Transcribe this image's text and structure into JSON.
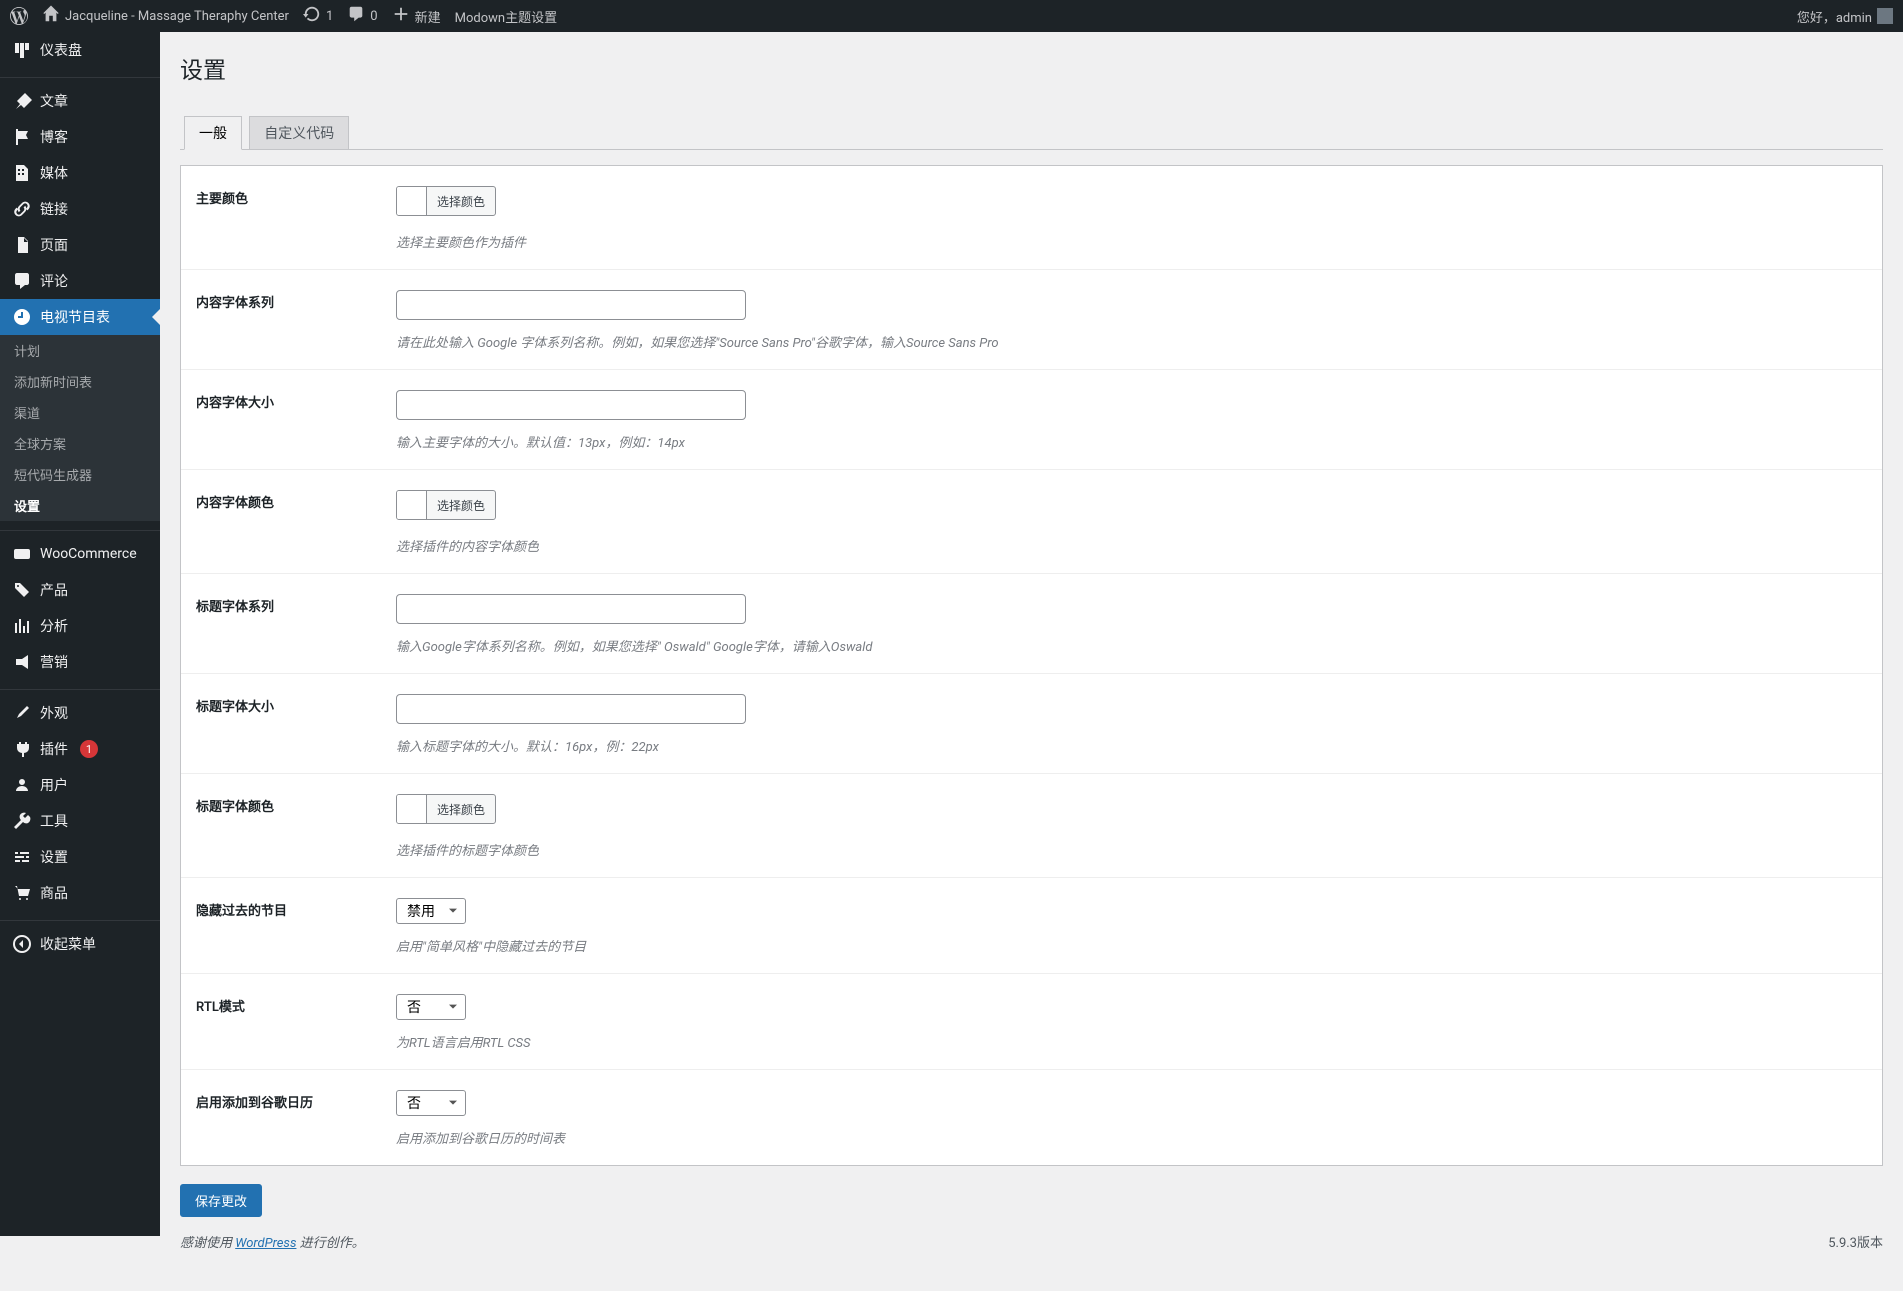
{
  "adminbar": {
    "site_name": "Jacqueline - Massage Theraphy Center",
    "updates_count": "1",
    "comments_count": "0",
    "new_label": "新建",
    "modown_label": "Modown主题设置",
    "greeting": "您好，admin"
  },
  "sidebar": {
    "dashboard": "仪表盘",
    "posts": "文章",
    "blog": "博客",
    "media": "媒体",
    "links": "链接",
    "pages": "页面",
    "comments": "评论",
    "tv_schedule": "电视节目表",
    "sub_plan": "计划",
    "sub_add_timesheet": "添加新时间表",
    "sub_channel": "渠道",
    "sub_global_plan": "全球方案",
    "sub_shortcode_gen": "短代码生成器",
    "sub_settings": "设置",
    "woocommerce": "WooCommerce",
    "products": "产品",
    "analytics": "分析",
    "marketing": "营销",
    "appearance": "外观",
    "plugins": "插件",
    "plugins_count": "1",
    "users": "用户",
    "tools": "工具",
    "settings": "设置",
    "shop": "商品",
    "collapse": "收起菜单"
  },
  "page": {
    "title": "设置"
  },
  "tabs": {
    "general": "一般",
    "custom_code": "自定义代码"
  },
  "form": {
    "main_color": {
      "label": "主要颜色",
      "help": "选择主要颜色作为插件"
    },
    "content_font_family": {
      "label": "内容字体系列",
      "help": "请在此处输入 Google 字体系列名称。例如，如果您选择\"Source Sans Pro\"谷歌字体，输入Source Sans Pro"
    },
    "content_font_size": {
      "label": "内容字体大小",
      "help": "输入主要字体的大小。默认值：13px，例如：14px"
    },
    "content_font_color": {
      "label": "内容字体颜色",
      "help": "选择插件的内容字体颜色"
    },
    "title_font_family": {
      "label": "标题字体系列",
      "help": "输入Google字体系列名称。例如，如果您选择\" Oswald\" Google字体，请输入Oswald"
    },
    "title_font_size": {
      "label": "标题字体大小",
      "help": "输入标题字体的大小。默认：16px，例：22px"
    },
    "title_font_color": {
      "label": "标题字体颜色",
      "help": "选择插件的标题字体颜色"
    },
    "hide_past": {
      "label": "隐藏过去的节目",
      "help": "启用\"简单风格\"中隐藏过去的节目",
      "value": "禁用"
    },
    "rtl_mode": {
      "label": "RTL模式",
      "help": "为RTL语言启用RTL CSS",
      "value": "否"
    },
    "add_gcal": {
      "label": "启用添加到谷歌日历",
      "help": "启用添加到谷歌日历的时间表",
      "value": "否"
    },
    "color_picker_label": "选择颜色",
    "submit": "保存更改"
  },
  "footer": {
    "thanks_prefix": "感谢使用 ",
    "wordpress_link": "WordPress",
    "thanks_suffix": " 进行创作。",
    "version": "5.9.3版本"
  }
}
